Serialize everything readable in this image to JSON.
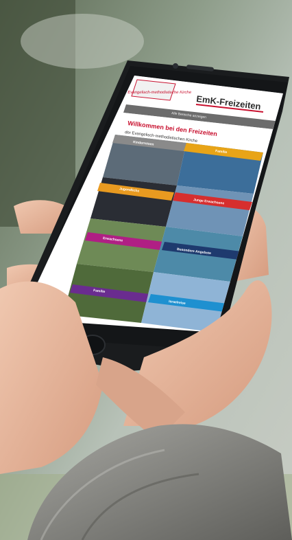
{
  "app": {
    "logo_text": "Evangelisch-methodistische Kirche",
    "header_title": "EmK-Freizeiten",
    "nav_text": "Alle Bereiche anzeigen",
    "headline": "Willkommen bei den Freizeiten",
    "subheadline": "der Evangelisch-methodistischen Kirche"
  },
  "tiles": [
    {
      "label": "Kinderreisen",
      "color": "#8a8a8a"
    },
    {
      "label": "Familie",
      "color": "#e8a417"
    },
    {
      "label": "Jugendliche",
      "color": "#e89a20"
    },
    {
      "label": "Junge Erwachsene",
      "color": "#d62e2e"
    },
    {
      "label": "Erwachsene",
      "color": "#b01f84"
    },
    {
      "label": "Besondere Angebote",
      "color": "#1e3a6e"
    },
    {
      "label": "Familie",
      "color": "#6a2c8f"
    },
    {
      "label": "Israelreise",
      "color": "#1e90d0"
    }
  ],
  "colors": {
    "brand_red": "#c8102e",
    "phone_body": "#1a1c1e",
    "sleeve": "#8a8a86",
    "skin": "#e6b49a"
  }
}
